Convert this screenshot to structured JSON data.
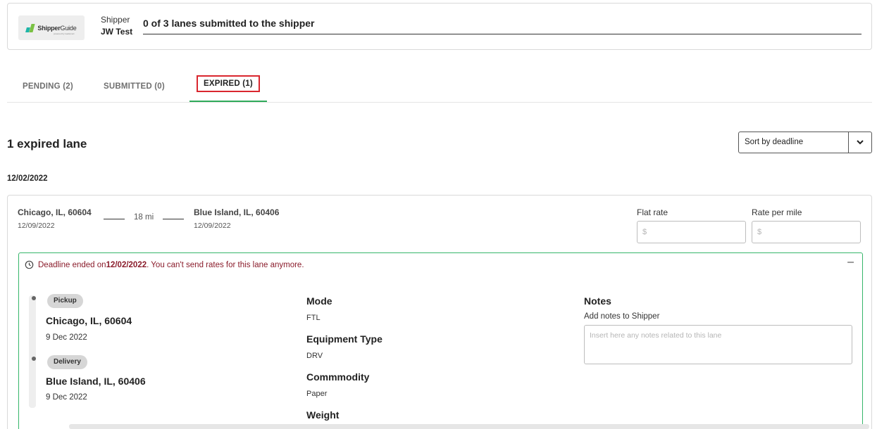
{
  "header": {
    "logo_brand": "Shipper",
    "logo_brand2": "Guide",
    "logo_sub": "powered by loadsmart",
    "shipper_label": "Shipper",
    "shipper_name": "JW Test",
    "progress_text": "0 of 3 lanes submitted to the shipper"
  },
  "tabs": [
    {
      "label": "PENDING (2)"
    },
    {
      "label": "SUBMITTED (0)"
    },
    {
      "label": "EXPIRED (1)"
    }
  ],
  "lane_count": "1 expired lane",
  "sort": {
    "value": "Sort by deadline"
  },
  "deadline_group": "12/02/2022",
  "lane": {
    "origin_city": "Chicago, IL, 60604",
    "origin_date": "12/09/2022",
    "distance": "18 mi",
    "dest_city": "Blue Island, IL, 60406",
    "dest_date": "12/09/2022",
    "flat_rate_label": "Flat rate",
    "flat_rate_placeholder": "$",
    "per_mile_label": "Rate per mile",
    "per_mile_placeholder": "$"
  },
  "details": {
    "deadline_prefix": "Deadline ended on ",
    "deadline_date": "12/02/2022",
    "deadline_suffix": ". You can't send rates for this lane anymore.",
    "collapse_symbol": "–",
    "pickup_label": "Pickup",
    "pickup_city": "Chicago, IL, 60604",
    "pickup_date": "9 Dec 2022",
    "delivery_label": "Delivery",
    "delivery_city": "Blue Island, IL, 60406",
    "delivery_date": "9 Dec 2022",
    "mode_label": "Mode",
    "mode_value": "FTL",
    "equipment_label": "Equipment Type",
    "equipment_value": "DRV",
    "commodity_label": "Commmodity",
    "commodity_value": "Paper",
    "weight_label": "Weight",
    "notes_label": "Notes",
    "notes_sub": "Add notes to Shipper",
    "notes_placeholder": "Insert here any notes related to this lane"
  },
  "colors": {
    "accent_green": "#2eaa5a",
    "highlight_red": "#d9262e",
    "deadline_text": "#8a1c2b"
  },
  "icons": {
    "clock": "clock-icon",
    "chevron": "chevron-down-icon"
  }
}
